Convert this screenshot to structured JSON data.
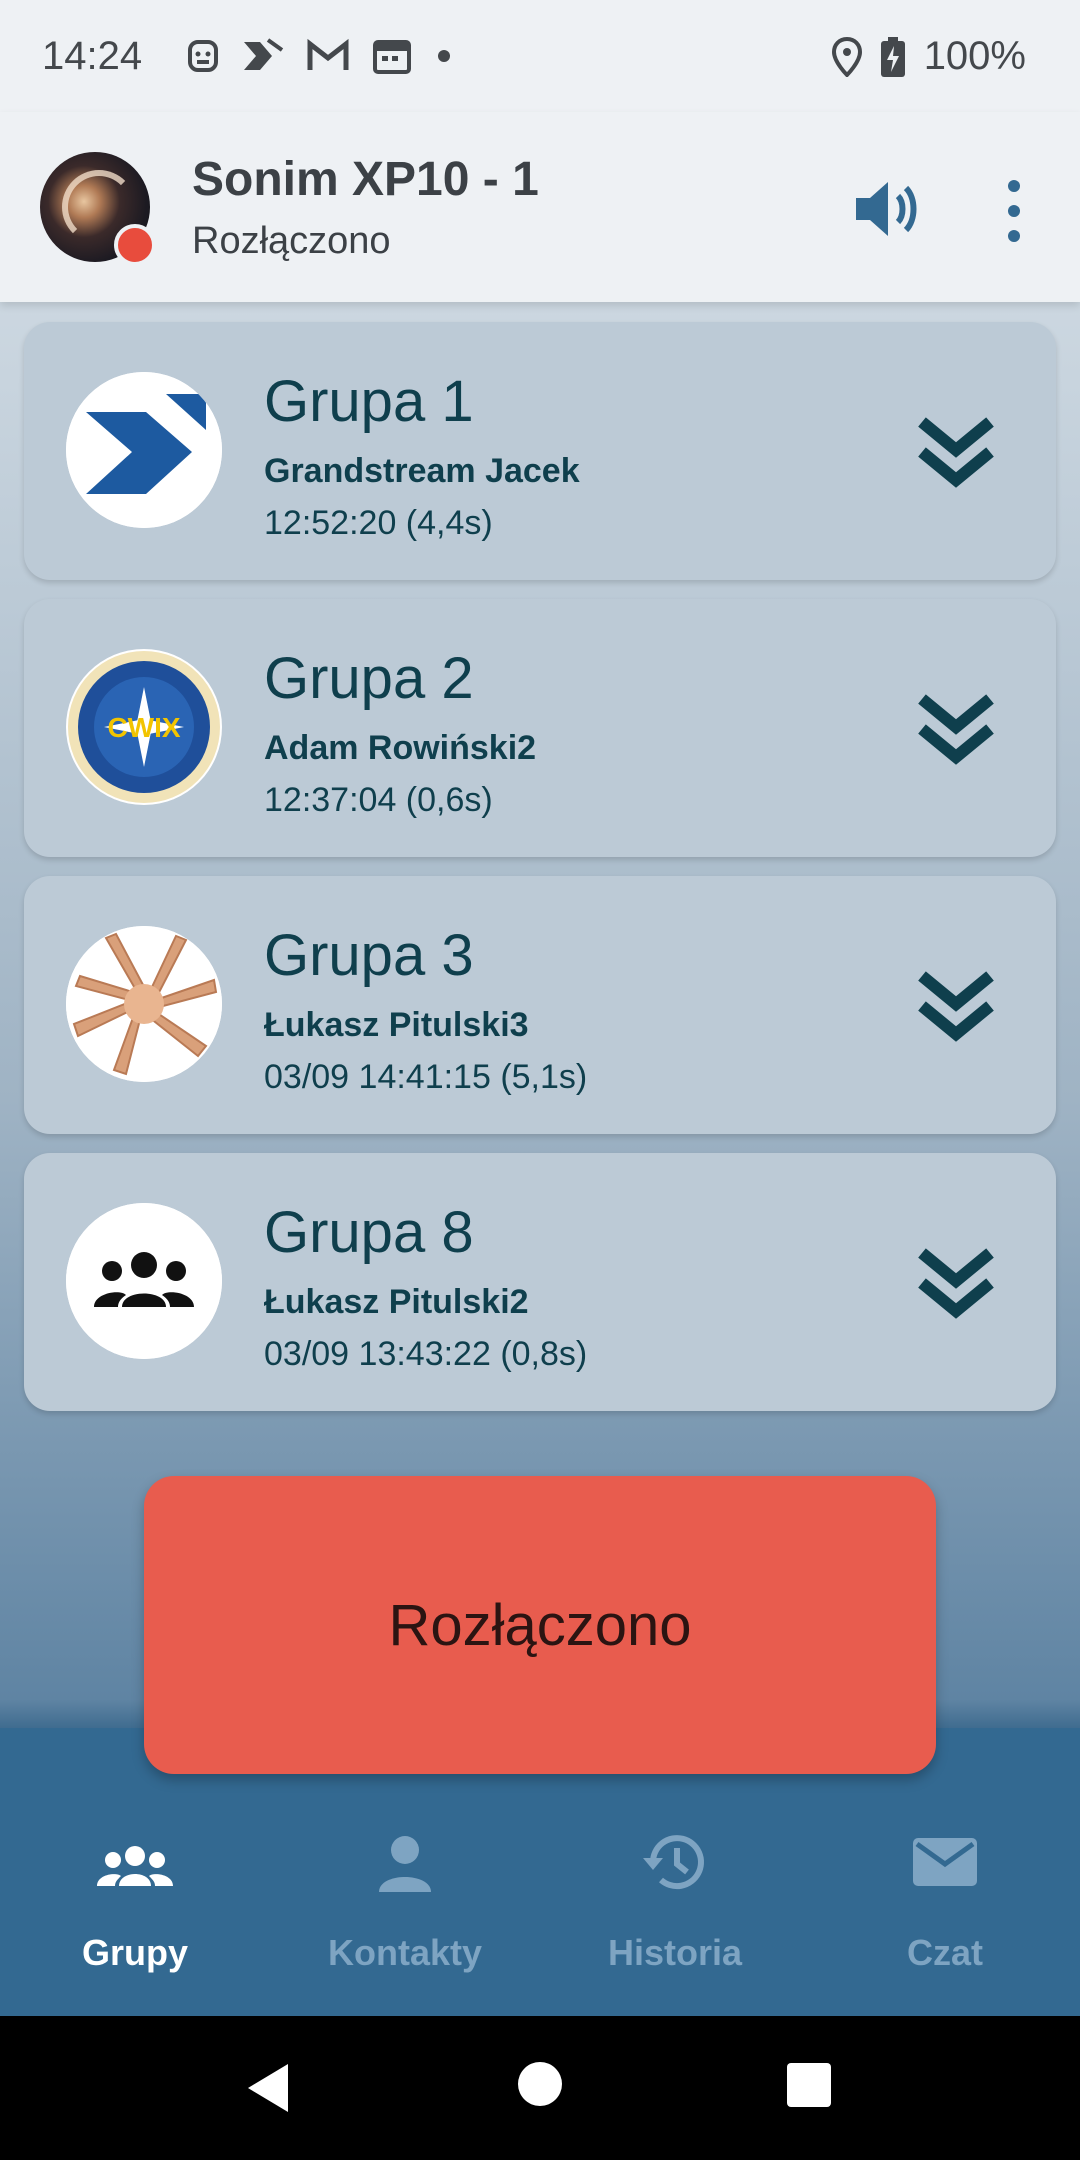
{
  "status_bar": {
    "time": "14:24",
    "battery": "100%",
    "notification_icons": [
      "android-head-icon",
      "arrow-icon",
      "gmail-icon",
      "calendar-icon",
      "dot-icon"
    ]
  },
  "header": {
    "device_name": "Sonim XP10 - 1",
    "connection_status": "Rozłączono",
    "status_dot_color": "#e84c3d"
  },
  "groups": [
    {
      "name": "Grupa 1",
      "caller": "Grandstream Jacek",
      "time": "12:52:20 (4,4s)",
      "icon": "arrow-logo-icon"
    },
    {
      "name": "Grupa 2",
      "caller": "Adam Rowiński2",
      "time": "12:37:04 (0,6s)",
      "icon": "cwix-logo-icon",
      "logo_text": "CWIX"
    },
    {
      "name": "Grupa 3",
      "caller": "Łukasz Pitulski3",
      "time": "03/09 14:41:15 (5,1s)",
      "icon": "hands-photo-icon"
    },
    {
      "name": "Grupa 8",
      "caller": "Łukasz Pitulski2",
      "time": "03/09 13:43:22 (0,8s)",
      "icon": "people-icon"
    }
  ],
  "ptt_button": {
    "label": "Rozłączono",
    "color": "#e85c4e"
  },
  "bottom_nav": [
    {
      "label": "Grupy",
      "icon": "groups-icon",
      "active": true
    },
    {
      "label": "Kontakty",
      "icon": "person-icon",
      "active": false
    },
    {
      "label": "Historia",
      "icon": "history-icon",
      "active": false
    },
    {
      "label": "Czat",
      "icon": "mail-icon",
      "active": false
    }
  ],
  "colors": {
    "accent": "#336991",
    "text_dark": "#0f3f4d",
    "card": "#bccad6"
  }
}
